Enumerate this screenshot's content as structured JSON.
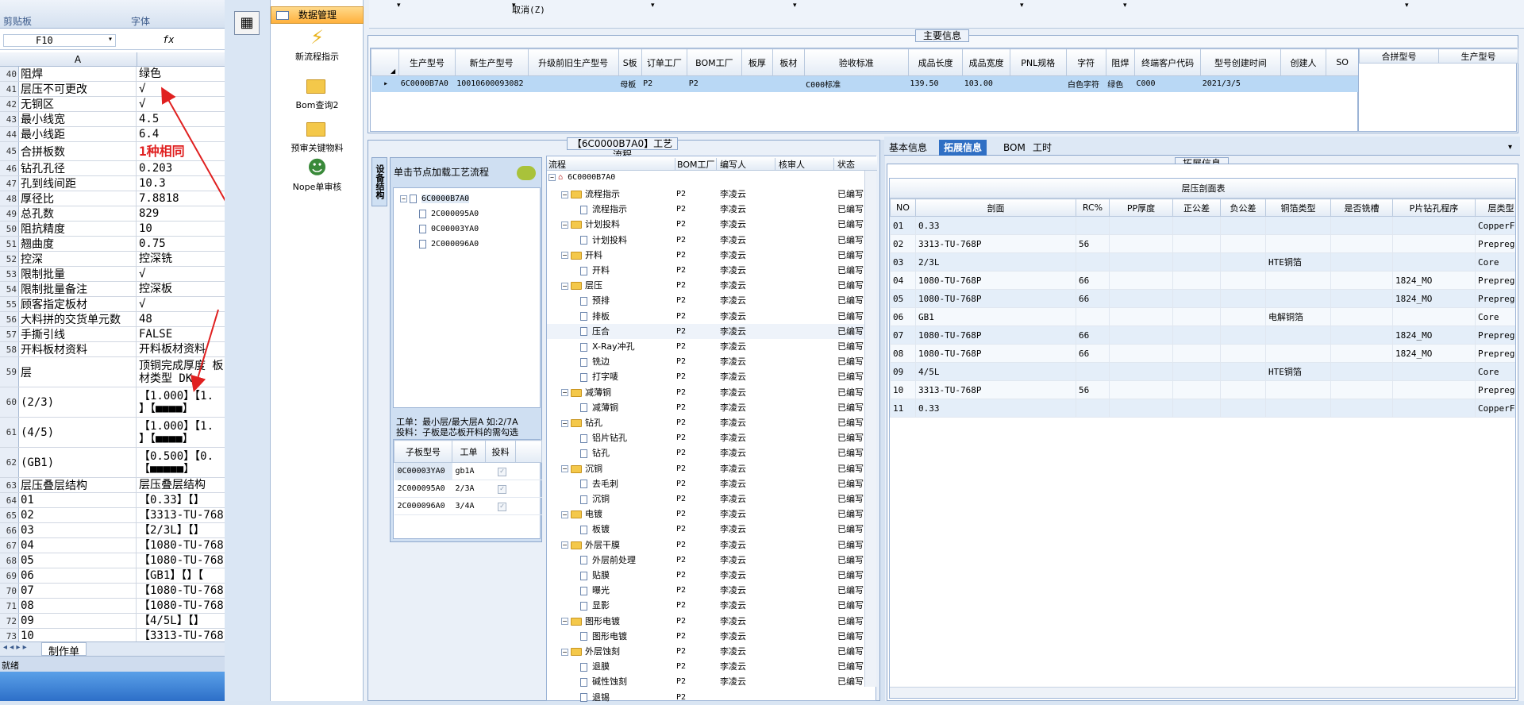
{
  "excel": {
    "ribbon": {
      "clipboard_label": "剪贴板",
      "font_label": "字体"
    },
    "name_box": "F10",
    "fx": "fx",
    "column_header": "A",
    "rows": [
      {
        "n": "40",
        "a": "阻焊",
        "b": "绿色"
      },
      {
        "n": "41",
        "a": "层压不可更改",
        "b": "√"
      },
      {
        "n": "42",
        "a": "无铜区",
        "b": "√"
      },
      {
        "n": "43",
        "a": "最小线宽",
        "b": "4.5"
      },
      {
        "n": "44",
        "a": "最小线距",
        "b": "6.4"
      },
      {
        "n": "45",
        "a": "合拼板数",
        "b": "1种相同"
      },
      {
        "n": "46",
        "a": "钻孔孔径",
        "b": "0.203"
      },
      {
        "n": "47",
        "a": "孔到线间距",
        "b": "10.3"
      },
      {
        "n": "48",
        "a": "厚径比",
        "b": "7.8818"
      },
      {
        "n": "49",
        "a": "总孔数",
        "b": "829"
      },
      {
        "n": "50",
        "a": "阻抗精度",
        "b": "10"
      },
      {
        "n": "51",
        "a": "翘曲度",
        "b": "0.75"
      },
      {
        "n": "52",
        "a": "控深",
        "b": "控深铣"
      },
      {
        "n": "53",
        "a": "限制批量",
        "b": "√"
      },
      {
        "n": "54",
        "a": "限制批量备注",
        "b": "控深板"
      },
      {
        "n": "55",
        "a": "顾客指定板材",
        "b": "√"
      },
      {
        "n": "56",
        "a": "大料拼的交货单元数",
        "b": "48"
      },
      {
        "n": "57",
        "a": "手撕引线",
        "b": "FALSE"
      },
      {
        "n": "58",
        "a": "开料板材资料",
        "b": "开料板材资料"
      },
      {
        "n": "59",
        "a": "层",
        "b": "顶铜完成厚度 板材类型 DK"
      },
      {
        "n": "60",
        "a": "(2/3)",
        "b": "【1.000】【1. 】【■■■■】"
      },
      {
        "n": "61",
        "a": "(4/5)",
        "b": "【1.000】【1. 】【■■■■】"
      },
      {
        "n": "62",
        "a": "(GB1)",
        "b": "【0.500】【0. 【■■■■■】"
      },
      {
        "n": "63",
        "a": "层压叠层结构",
        "b": "层压叠层结构"
      },
      {
        "n": "64",
        "a": "01",
        "b": "【0.33】【】"
      },
      {
        "n": "65",
        "a": "02",
        "b": "【3313-TU-768"
      },
      {
        "n": "66",
        "a": "03",
        "b": "【2/3L】【】"
      },
      {
        "n": "67",
        "a": "04",
        "b": "【1080-TU-768"
      },
      {
        "n": "68",
        "a": "05",
        "b": "【1080-TU-768"
      },
      {
        "n": "69",
        "a": "06",
        "b": "【GB1】【】【"
      },
      {
        "n": "70",
        "a": "07",
        "b": "【1080-TU-768"
      },
      {
        "n": "71",
        "a": "08",
        "b": "【1080-TU-768"
      },
      {
        "n": "72",
        "a": "09",
        "b": "【4/5L】【】"
      },
      {
        "n": "73",
        "a": "10",
        "b": "【3313-TU-768"
      }
    ],
    "sheet_tab": "制作单",
    "status": "就绪"
  },
  "nav": {
    "header": "数据管理",
    "items": [
      {
        "label": "新流程指示",
        "icon": "lightning-icon"
      },
      {
        "label": "Bom查询2",
        "icon": "folder-icon"
      },
      {
        "label": "预审关键物料",
        "icon": "folder-icon"
      },
      {
        "label": "Nope单审核",
        "icon": "user-icon"
      }
    ]
  },
  "toolbar": {
    "cancel_label": "取消(Z)"
  },
  "main_info": {
    "title": "主要信息",
    "columns": [
      "生产型号",
      "新生产型号",
      "升级前旧生产型号",
      "S板",
      "订单工厂",
      "BOM工厂",
      "板厚",
      "板材",
      "验收标准",
      "成品长度",
      "成品宽度",
      "PNL规格",
      "字符",
      "阻焊",
      "终端客户代码",
      "型号创建时间",
      "创建人",
      "SO"
    ],
    "row": [
      "6C0000B7A0",
      "10010600093082",
      "",
      "母板",
      "P2",
      "P2",
      "",
      "",
      "C000标准",
      "139.50",
      "103.00",
      "",
      "白色字符",
      "绿色",
      "C000",
      "2021/3/5",
      "",
      ""
    ],
    "merge_columns": [
      "合拼型号",
      "生产型号"
    ]
  },
  "process": {
    "title": "【6C0000B7A0】工艺流程",
    "side_tab": "设备结构",
    "load_hint": "单击节点加载工艺流程",
    "tree_root": "6C0000B7A0",
    "tree_children": [
      "2C000095A0",
      "0C00003YA0",
      "2C000096A0"
    ],
    "hint1": "工单：最小层/最大层A 如:2/7A",
    "hint2": "投料：子板是芯板开料的需勾选",
    "sub_columns": [
      "子板型号",
      "工单",
      "投料"
    ],
    "sub_rows": [
      {
        "model": "0C00003YA0",
        "wo": "gb1A"
      },
      {
        "model": "2C000095A0",
        "wo": "2/3A"
      },
      {
        "model": "2C000096A0",
        "wo": "3/4A"
      }
    ],
    "flow_columns": [
      "流程",
      "BOM工厂",
      "编写人",
      "核审人",
      "状态"
    ],
    "flow_root": "6C0000B7A0",
    "flow": [
      {
        "lvl": 1,
        "name": "流程指示",
        "bom": "P2",
        "author": "李凌云",
        "status": "已编写"
      },
      {
        "lvl": 2,
        "name": "流程指示",
        "bom": "P2",
        "author": "李凌云",
        "status": "已编写"
      },
      {
        "lvl": 1,
        "name": "计划投料",
        "bom": "P2",
        "author": "李凌云",
        "status": "已编写"
      },
      {
        "lvl": 2,
        "name": "计划投料",
        "bom": "P2",
        "author": "李凌云",
        "status": "已编写"
      },
      {
        "lvl": 1,
        "name": "开料",
        "bom": "P2",
        "author": "李凌云",
        "status": "已编写"
      },
      {
        "lvl": 2,
        "name": "开料",
        "bom": "P2",
        "author": "李凌云",
        "status": "已编写"
      },
      {
        "lvl": 1,
        "name": "层压",
        "bom": "P2",
        "author": "李凌云",
        "status": "已编写"
      },
      {
        "lvl": 2,
        "name": "预排",
        "bom": "P2",
        "author": "李凌云",
        "status": "已编写"
      },
      {
        "lvl": 2,
        "name": "排板",
        "bom": "P2",
        "author": "李凌云",
        "status": "已编写"
      },
      {
        "lvl": 2,
        "name": "压合",
        "bom": "P2",
        "author": "李凌云",
        "status": "已编写"
      },
      {
        "lvl": 2,
        "name": "X-Ray冲孔",
        "bom": "P2",
        "author": "李凌云",
        "status": "已编写"
      },
      {
        "lvl": 2,
        "name": "铣边",
        "bom": "P2",
        "author": "李凌云",
        "status": "已编写"
      },
      {
        "lvl": 2,
        "name": "打字唛",
        "bom": "P2",
        "author": "李凌云",
        "status": "已编写"
      },
      {
        "lvl": 1,
        "name": "减薄铜",
        "bom": "P2",
        "author": "李凌云",
        "status": "已编写"
      },
      {
        "lvl": 2,
        "name": "减薄铜",
        "bom": "P2",
        "author": "李凌云",
        "status": "已编写"
      },
      {
        "lvl": 1,
        "name": "钻孔",
        "bom": "P2",
        "author": "李凌云",
        "status": "已编写"
      },
      {
        "lvl": 2,
        "name": "铝片钻孔",
        "bom": "P2",
        "author": "李凌云",
        "status": "已编写"
      },
      {
        "lvl": 2,
        "name": "钻孔",
        "bom": "P2",
        "author": "李凌云",
        "status": "已编写"
      },
      {
        "lvl": 1,
        "name": "沉铜",
        "bom": "P2",
        "author": "李凌云",
        "status": "已编写"
      },
      {
        "lvl": 2,
        "name": "去毛刺",
        "bom": "P2",
        "author": "李凌云",
        "status": "已编写"
      },
      {
        "lvl": 2,
        "name": "沉铜",
        "bom": "P2",
        "author": "李凌云",
        "status": "已编写"
      },
      {
        "lvl": 1,
        "name": "电镀",
        "bom": "P2",
        "author": "李凌云",
        "status": "已编写"
      },
      {
        "lvl": 2,
        "name": "板镀",
        "bom": "P2",
        "author": "李凌云",
        "status": "已编写"
      },
      {
        "lvl": 1,
        "name": "外层干膜",
        "bom": "P2",
        "author": "李凌云",
        "status": "已编写"
      },
      {
        "lvl": 2,
        "name": "外层前处理",
        "bom": "P2",
        "author": "李凌云",
        "status": "已编写"
      },
      {
        "lvl": 2,
        "name": "贴膜",
        "bom": "P2",
        "author": "李凌云",
        "status": "已编写"
      },
      {
        "lvl": 2,
        "name": "曝光",
        "bom": "P2",
        "author": "李凌云",
        "status": "已编写"
      },
      {
        "lvl": 2,
        "name": "显影",
        "bom": "P2",
        "author": "李凌云",
        "status": "已编写"
      },
      {
        "lvl": 1,
        "name": "图形电镀",
        "bom": "P2",
        "author": "李凌云",
        "status": "已编写"
      },
      {
        "lvl": 2,
        "name": "图形电镀",
        "bom": "P2",
        "author": "李凌云",
        "status": "已编写"
      },
      {
        "lvl": 1,
        "name": "外层蚀刻",
        "bom": "P2",
        "author": "李凌云",
        "status": "已编写"
      },
      {
        "lvl": 2,
        "name": "退膜",
        "bom": "P2",
        "author": "李凌云",
        "status": "已编写"
      },
      {
        "lvl": 2,
        "name": "碱性蚀刻",
        "bom": "P2",
        "author": "李凌云",
        "status": "已编写"
      },
      {
        "lvl": 2,
        "name": "退锡",
        "bom": "P2",
        "author": "",
        "status": ""
      }
    ]
  },
  "detail": {
    "tabs": [
      "基本信息",
      "拓展信息",
      "BOM",
      "工时"
    ],
    "active_tab": "拓展信息",
    "group_title": "拓展信息",
    "table_title": "层压剖面表",
    "columns": [
      "NO",
      "剖面",
      "RC%",
      "PP厚度",
      "正公差",
      "负公差",
      "铜箔类型",
      "是否铣槽",
      "P片钻孔程序",
      "层类型"
    ],
    "rows": [
      [
        "01",
        "0.33",
        "",
        "",
        "",
        "",
        "",
        "",
        "",
        "CopperFo"
      ],
      [
        "02",
        "3313-TU-768P",
        "56",
        "",
        "",
        "",
        "",
        "",
        "",
        "Prepreg"
      ],
      [
        "03",
        "2/3L",
        "",
        "",
        "",
        "",
        "HTE铜箔",
        "",
        "",
        "Core"
      ],
      [
        "04",
        "1080-TU-768P",
        "66",
        "",
        "",
        "",
        "",
        "",
        "1824_MO",
        "Prepreg"
      ],
      [
        "05",
        "1080-TU-768P",
        "66",
        "",
        "",
        "",
        "",
        "",
        "1824_MO",
        "Prepreg"
      ],
      [
        "06",
        "GB1",
        "",
        "",
        "",
        "",
        "电解铜箔",
        "",
        "",
        "Core"
      ],
      [
        "07",
        "1080-TU-768P",
        "66",
        "",
        "",
        "",
        "",
        "",
        "1824_MO",
        "Prepreg"
      ],
      [
        "08",
        "1080-TU-768P",
        "66",
        "",
        "",
        "",
        "",
        "",
        "1824_MO",
        "Prepreg"
      ],
      [
        "09",
        "4/5L",
        "",
        "",
        "",
        "",
        "HTE铜箔",
        "",
        "",
        "Core"
      ],
      [
        "10",
        "3313-TU-768P",
        "56",
        "",
        "",
        "",
        "",
        "",
        "",
        "Prepreg"
      ],
      [
        "11",
        "0.33",
        "",
        "",
        "",
        "",
        "",
        "",
        "",
        "CopperFo"
      ]
    ]
  },
  "colors": {
    "annotation_red": "#e02020",
    "selected_row": "#b9d8f5",
    "active_tab": "#2f6fc4"
  }
}
